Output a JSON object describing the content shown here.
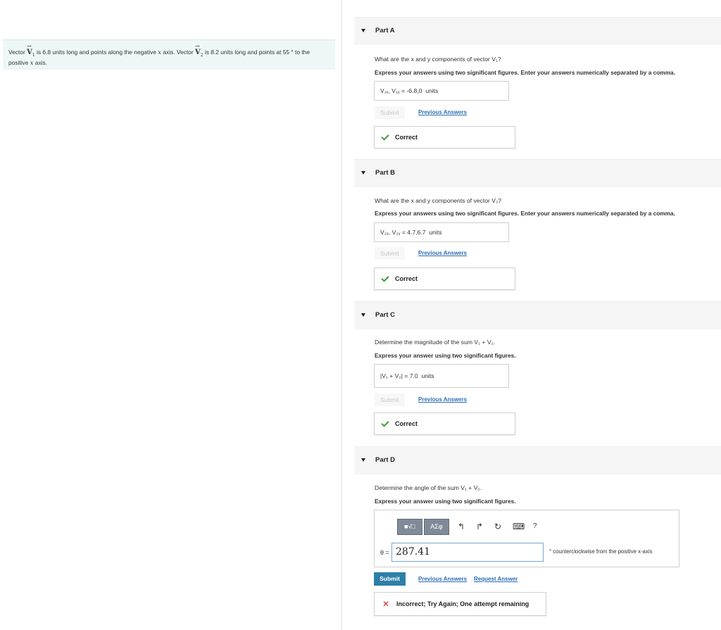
{
  "problem": {
    "t1": "Vector ",
    "v1": "V",
    "v1_sub": "1",
    "t2": " is 6.8 units long and points along the negative ",
    "x1": "x",
    "t3": " axis. Vector ",
    "v2": "V",
    "v2_sub": "2",
    "t4": " is 8.2 units long and points at 55 ° to the positive ",
    "x2": "x",
    "t5": " axis."
  },
  "partA": {
    "title": "Part A",
    "question": "What are the x and y components of vector V₁?",
    "instructions": "Express your answers using two significant figures. Enter your answers numerically separated by a comma.",
    "label": "V₁ₓ, V₁ᵧ = ",
    "answer": "-6.8,0",
    "unit": "units",
    "submit": "Submit",
    "previous": "Previous Answers",
    "feedback": "Correct"
  },
  "partB": {
    "title": "Part B",
    "question": "What are the x and y components of vector V₂?",
    "instructions": "Express your answers using two significant figures. Enter your answers numerically separated by a comma.",
    "label": "V₂ₓ, V₂ᵧ = ",
    "answer": "4.7,6.7",
    "unit": "units",
    "submit": "Submit",
    "previous": "Previous Answers",
    "feedback": "Correct"
  },
  "partC": {
    "title": "Part C",
    "question": "Determine the magnitude of the sum V₁ + V₂.",
    "instructions": "Express your answer using two significant figures.",
    "label": "|V₁ + V₂| = ",
    "answer": "7.0",
    "unit": "units",
    "submit": "Submit",
    "previous": "Previous Answers",
    "feedback": "Correct"
  },
  "partD": {
    "title": "Part D",
    "question": "Determine the angle of the sum V₁ + V₂.",
    "instructions": "Express your answer using two significant figures.",
    "toolbar": {
      "templates": "■√□",
      "greek": "ΑΣφ",
      "undo": "↰",
      "redo": "↱",
      "reset": "↻",
      "keyboard": "⌨",
      "help": "?"
    },
    "theta_label": "θ =",
    "answer": "287.41",
    "unit": "° counterclockwise from the positive x-axis",
    "submit": "Submit",
    "previous": "Previous Answers",
    "request": "Request Answer",
    "feedback": "Incorrect; Try Again; One attempt remaining"
  },
  "colors": {
    "accent": "#2e7fa8",
    "link": "#2b6eb5",
    "correct": "#3f9c35",
    "incorrect": "#d22b2b",
    "problem_bg": "#eef7f7"
  }
}
